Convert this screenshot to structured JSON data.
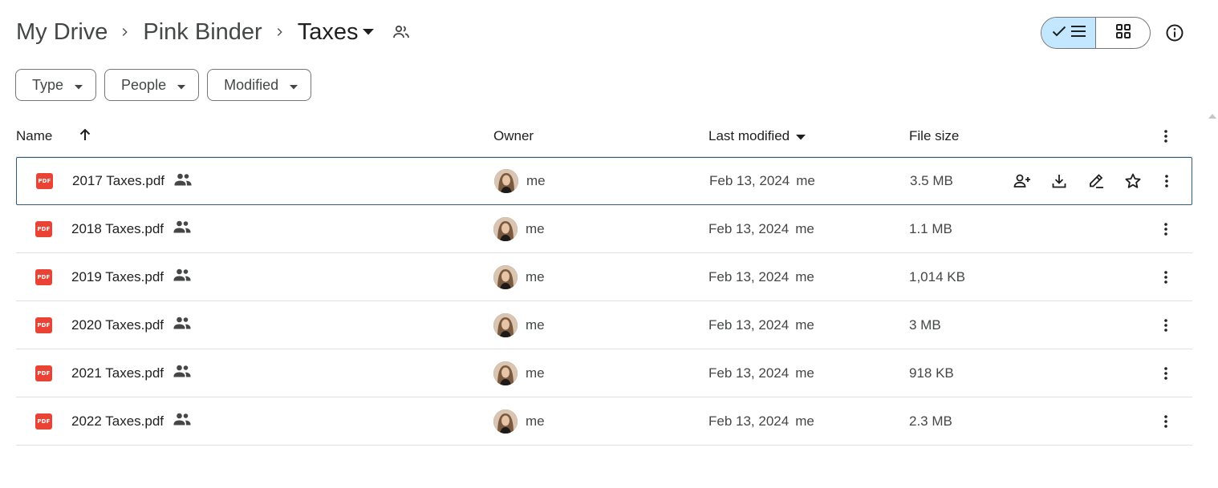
{
  "breadcrumb": {
    "items": [
      "My Drive",
      "Pink Binder",
      "Taxes"
    ]
  },
  "filters": {
    "type": "Type",
    "people": "People",
    "modified": "Modified"
  },
  "table": {
    "headers": {
      "name": "Name",
      "owner": "Owner",
      "modified": "Last modified",
      "size": "File size"
    },
    "rows": [
      {
        "name": "2017 Taxes.pdf",
        "owner": "me",
        "date": "Feb 13, 2024",
        "by": "me",
        "size": "3.5 MB"
      },
      {
        "name": "2018 Taxes.pdf",
        "owner": "me",
        "date": "Feb 13, 2024",
        "by": "me",
        "size": "1.1 MB"
      },
      {
        "name": "2019 Taxes.pdf",
        "owner": "me",
        "date": "Feb 13, 2024",
        "by": "me",
        "size": "1,014 KB"
      },
      {
        "name": "2020 Taxes.pdf",
        "owner": "me",
        "date": "Feb 13, 2024",
        "by": "me",
        "size": "3 MB"
      },
      {
        "name": "2021 Taxes.pdf",
        "owner": "me",
        "date": "Feb 13, 2024",
        "by": "me",
        "size": "918 KB"
      },
      {
        "name": "2022 Taxes.pdf",
        "owner": "me",
        "date": "Feb 13, 2024",
        "by": "me",
        "size": "2.3 MB"
      }
    ]
  },
  "file_type_label": "PDF",
  "icons": {
    "file": "pdf-icon",
    "shared": "people-icon",
    "row_actions": [
      "share-person-add-icon",
      "download-icon",
      "rename-icon",
      "star-icon"
    ],
    "more": "more-vert-icon"
  },
  "colors": {
    "accent": "#c2e7ff",
    "pdf": "#ea4335",
    "selected_border": "#2d5c80"
  }
}
